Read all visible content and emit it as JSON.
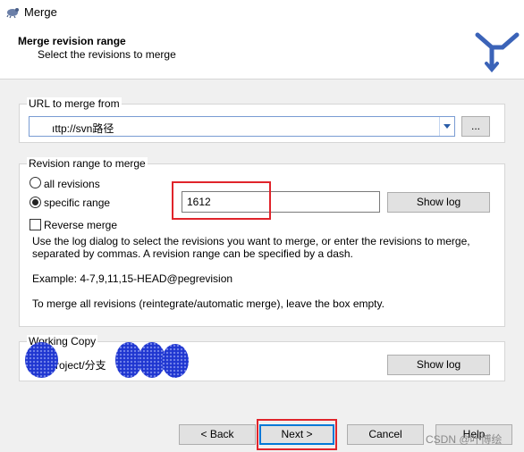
{
  "window": {
    "title": "Merge"
  },
  "header": {
    "title": "Merge revision range",
    "subtitle": "Select the revisions to merge"
  },
  "url_group": {
    "legend": "URL to merge from",
    "value": "ıttp://svn路径",
    "browse_label": "..."
  },
  "revision_group": {
    "legend": "Revision range to merge",
    "all_revisions_label": "all revisions",
    "specific_range_label": "specific range",
    "selected": "specific range",
    "range_value": "1612",
    "show_log_label": "Show log",
    "reverse_merge_label": "Reverse merge",
    "reverse_merge_checked": false,
    "help_text": "Use the log dialog to select the revisions you want to merge, or enter the revisions to merge, separated by commas. A revision range can be specified by a dash.",
    "example_text": "Example: 4-7,9,11,15-HEAD@pegrevision",
    "merge_all_text": "To merge all revisions (reintegrate/automatic merge), leave the box empty."
  },
  "working_copy_group": {
    "legend": "Working Copy",
    "path_fragment": "roject/分支",
    "show_log_label": "Show log"
  },
  "footer": {
    "back_label": "< Back",
    "next_label": "Next >",
    "cancel_label": "Cancel",
    "help_label": "Help"
  },
  "watermark": "CSDN @叶博绘",
  "colors": {
    "highlight_box": "#e0242b",
    "redaction_blob": "#2a3dd6",
    "focus_border": "#0078d7"
  }
}
